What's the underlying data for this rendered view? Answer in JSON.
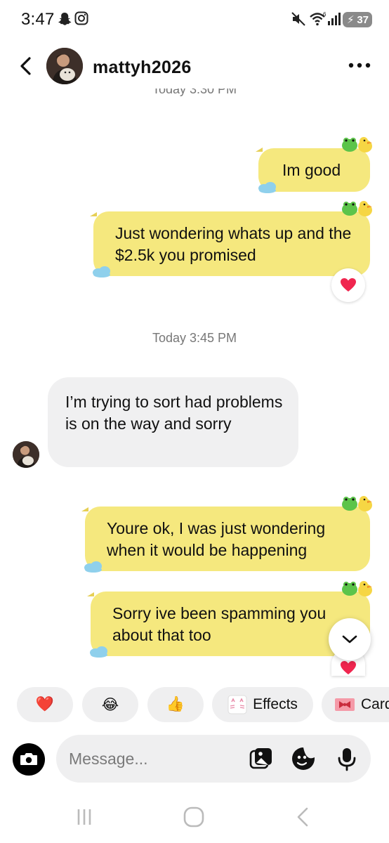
{
  "status_bar": {
    "time": "3:47",
    "battery": "37"
  },
  "header": {
    "username": "mattyh2026"
  },
  "timestamps": {
    "first": "Today 3:30 PM",
    "second": "Today 3:45 PM"
  },
  "messages": [
    {
      "direction": "outgoing",
      "text": "Im good"
    },
    {
      "direction": "outgoing",
      "text": "Just wondering whats up and the $2.5k you promised",
      "reaction": "heart"
    },
    {
      "direction": "incoming",
      "text": "I’m trying to sort had problems is on the way and sorry"
    },
    {
      "direction": "outgoing",
      "text": "Youre ok, I was just wondering when it would be happening"
    },
    {
      "direction": "outgoing",
      "text": "Sorry ive been spamming you about that too",
      "reaction": "heart"
    }
  ],
  "quick_replies": {
    "heart": "❤️",
    "laugh": "😂",
    "thumbs": "👍",
    "effects": "Effects",
    "cards": "Card"
  },
  "composer": {
    "placeholder": "Message..."
  },
  "colors": {
    "outgoing_bubble": "#f5e87e",
    "incoming_bubble": "#f0f0f1",
    "heart": "#f0264f"
  }
}
